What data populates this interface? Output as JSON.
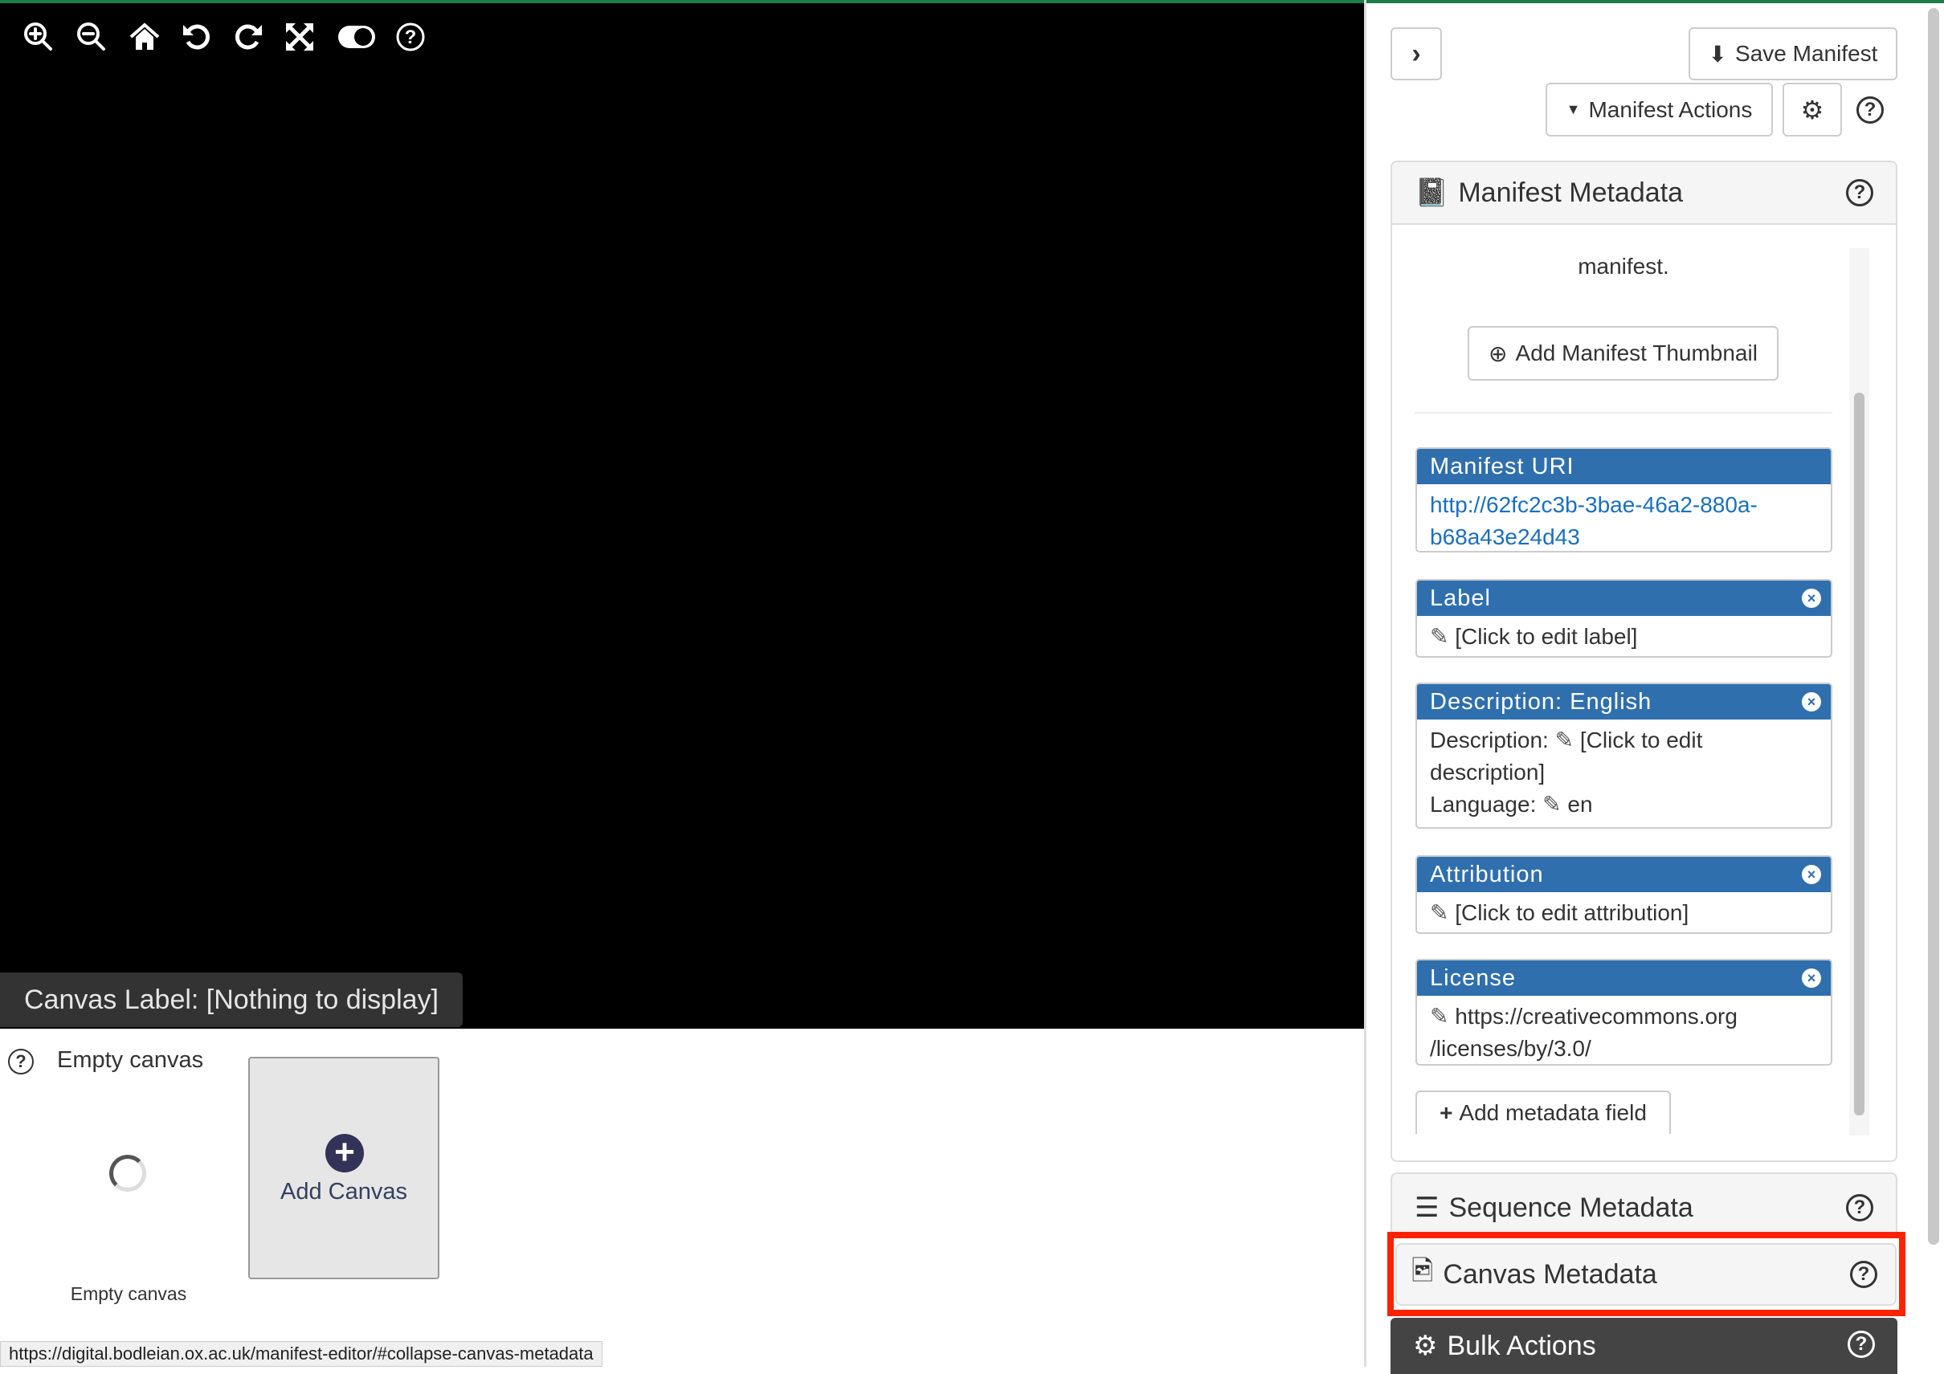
{
  "viewer": {
    "toolbar": [
      {
        "icon": "zoom-in-icon"
      },
      {
        "icon": "zoom-out-icon"
      },
      {
        "icon": "home-icon"
      },
      {
        "icon": "rotate-left-icon"
      },
      {
        "icon": "rotate-right-icon"
      },
      {
        "icon": "fullscreen-icon"
      },
      {
        "icon": "toggle-icon"
      },
      {
        "icon": "help-icon"
      }
    ],
    "canvas_label": "Canvas Label: [Nothing to display]"
  },
  "canvas_strip": {
    "help": "?",
    "title": "Empty canvas",
    "thumbnail_caption": "Empty canvas",
    "add_canvas_label": "Add Canvas"
  },
  "status_url": "https://digital.bodleian.ox.ac.uk/manifest-editor/#collapse-canvas-metadata",
  "sidebar": {
    "save_label": "Save Manifest",
    "actions_label": "Manifest Actions",
    "manifest_metadata": {
      "title": "Manifest Metadata",
      "text_fragment": "manifest.",
      "add_thumbnail_label": "Add Manifest Thumbnail",
      "cards": {
        "uri": {
          "title": "Manifest URI",
          "line1": "http://62fc2c3b-3bae-46a2-880a-",
          "line2": "b68a43e24d43"
        },
        "label": {
          "title": "Label",
          "value": "[Click to edit label]"
        },
        "description": {
          "title": "Description: English",
          "desc_label": "Description:",
          "desc_value": "[Click to edit",
          "desc_value2": "description]",
          "lang_label": "Language:",
          "lang_value": "en"
        },
        "attribution": {
          "title": "Attribution",
          "value": "[Click to edit attribution]"
        },
        "license": {
          "title": "License",
          "line1": "https://creativecommons.org",
          "line2": "/licenses/by/3.0/"
        }
      },
      "add_field_label": "Add metadata field"
    },
    "sequence_metadata": {
      "title": "Sequence Metadata"
    },
    "canvas_metadata": {
      "title": "Canvas Metadata"
    },
    "bulk_actions": {
      "title": "Bulk Actions"
    }
  },
  "colors": {
    "accent": "#2f6fae",
    "highlight": "#ff2200",
    "top_bar": "#1a7f4a",
    "bulk_bg": "#444444"
  }
}
